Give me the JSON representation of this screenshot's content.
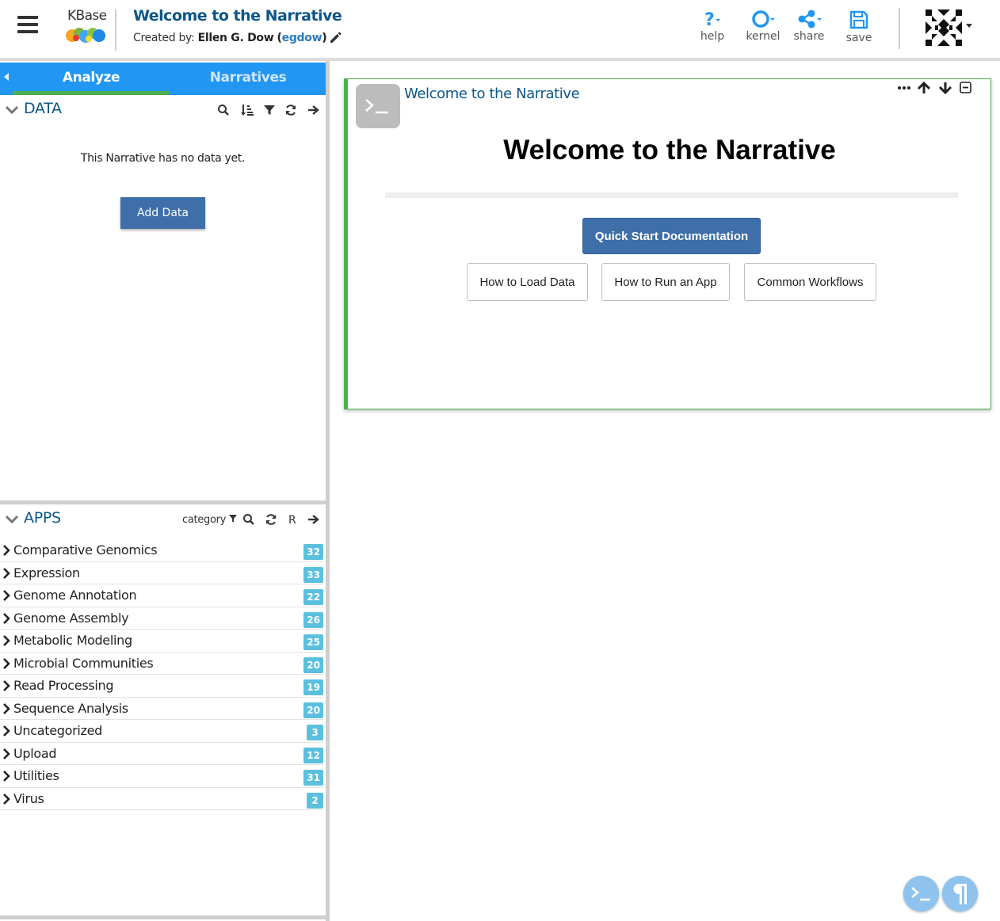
{
  "header": {
    "logo_text": "KBase",
    "narrative_title": "Welcome to the Narrative",
    "created_by_prefix": "Created by:",
    "owner_name": "Ellen G. Dow",
    "owner_paren_open": "(",
    "owner_userid": "egdow",
    "owner_paren_close": ")",
    "buttons": [
      {
        "label": "help",
        "icon": "question-icon"
      },
      {
        "label": "kernel",
        "icon": "circle-icon"
      },
      {
        "label": "share",
        "icon": "share-icon"
      },
      {
        "label": "save",
        "icon": "floppy-icon"
      }
    ],
    "accent_color": "#0b5688",
    "icon_color": "#2196f3"
  },
  "side_panel": {
    "tabs": [
      {
        "label": "Analyze",
        "active": true
      },
      {
        "label": "Narratives",
        "active": false
      }
    ],
    "data_section": {
      "title": "DATA",
      "empty_message": "This Narrative has no data yet.",
      "add_button": "Add Data",
      "tools": [
        "search-icon",
        "sort-icon",
        "filter-icon",
        "refresh-icon",
        "arrow-right-icon"
      ]
    },
    "apps_section": {
      "title": "APPS",
      "category_label": "category",
      "r_label": "R",
      "categories": [
        {
          "name": "Comparative Genomics",
          "count": "32"
        },
        {
          "name": "Expression",
          "count": "33"
        },
        {
          "name": "Genome Annotation",
          "count": "22"
        },
        {
          "name": "Genome Assembly",
          "count": "26"
        },
        {
          "name": "Metabolic Modeling",
          "count": "25"
        },
        {
          "name": "Microbial Communities",
          "count": "20"
        },
        {
          "name": "Read Processing",
          "count": "19"
        },
        {
          "name": "Sequence Analysis",
          "count": "20"
        },
        {
          "name": "Uncategorized",
          "count": "3"
        },
        {
          "name": "Upload",
          "count": "12"
        },
        {
          "name": "Utilities",
          "count": "31"
        },
        {
          "name": "Virus",
          "count": "2"
        }
      ],
      "badge_color": "#5bc0de"
    }
  },
  "cell": {
    "title": "Welcome to the Narrative",
    "heading": "Welcome to the Narrative",
    "primary_button": "Quick Start Documentation",
    "buttons": [
      "How to Load Data",
      "How to Run an App",
      "Common Workflows"
    ],
    "border_color": "#4caf50"
  }
}
